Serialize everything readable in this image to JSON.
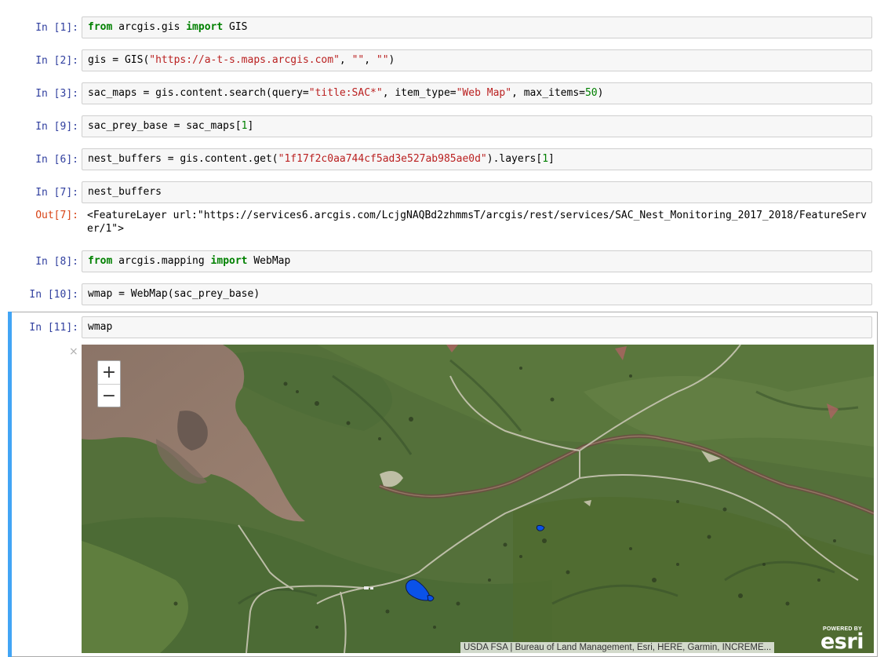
{
  "cells": [
    {
      "id": "c1",
      "prompt": "In [1]:",
      "tokens": [
        [
          "kw",
          "from"
        ],
        [
          "",
          " arcgis.gis "
        ],
        [
          "kw",
          "import"
        ],
        [
          "",
          " GIS"
        ]
      ]
    },
    {
      "id": "c2",
      "prompt": "In [2]:",
      "tokens": [
        [
          "",
          "gis = GIS("
        ],
        [
          "str",
          "\"https://a-t-s.maps.arcgis.com\""
        ],
        [
          "",
          ", "
        ],
        [
          "str",
          "\"\""
        ],
        [
          "",
          ", "
        ],
        [
          "str",
          "\"\""
        ],
        [
          "",
          ")"
        ]
      ]
    },
    {
      "id": "c3",
      "prompt": "In [3]:",
      "tokens": [
        [
          "",
          "sac_maps = gis.content.search(query="
        ],
        [
          "str",
          "\"title:SAC*\""
        ],
        [
          "",
          ", item_type="
        ],
        [
          "str",
          "\"Web Map\""
        ],
        [
          "",
          ", max_items="
        ],
        [
          "num",
          "50"
        ],
        [
          "",
          ")"
        ]
      ]
    },
    {
      "id": "c4",
      "prompt": "In [9]:",
      "tokens": [
        [
          "",
          "sac_prey_base = sac_maps["
        ],
        [
          "num",
          "1"
        ],
        [
          "",
          "]"
        ]
      ]
    },
    {
      "id": "c5",
      "prompt": "In [6]:",
      "tokens": [
        [
          "",
          "nest_buffers = gis.content.get("
        ],
        [
          "str",
          "\"1f17f2c0aa744cf5ad3e527ab985ae0d\""
        ],
        [
          "",
          ").layers["
        ],
        [
          "num",
          "1"
        ],
        [
          "",
          "]"
        ]
      ]
    },
    {
      "id": "c6",
      "prompt": "In [7]:",
      "tokens": [
        [
          "",
          "nest_buffers"
        ]
      ]
    },
    {
      "id": "c7",
      "prompt": "In [8]:",
      "tokens": [
        [
          "kw",
          "from"
        ],
        [
          "",
          " arcgis.mapping "
        ],
        [
          "kw",
          "import"
        ],
        [
          "",
          " WebMap"
        ]
      ]
    },
    {
      "id": "c8",
      "prompt": "In [10]:",
      "tokens": [
        [
          "",
          "wmap = WebMap(sac_prey_base)"
        ]
      ]
    },
    {
      "id": "c9",
      "prompt": "In [11]:",
      "tokens": [
        [
          "",
          "wmap"
        ]
      ]
    }
  ],
  "output7": {
    "prompt": "Out[7]:",
    "text": "<FeatureLayer url:\"https://services6.arcgis.com/LcjgNAQBd2zhmmsT/arcgis/rest/services/SAC_Nest_Monitoring_2017_2018/FeatureServer/1\">"
  },
  "widget": {
    "close_symbol": "×",
    "zoom_in": "+",
    "zoom_out": "−",
    "attribution": "USDA FSA | Bureau of Land Management, Esri, HERE, Garmin, INCREME...",
    "powered_by": "POWERED BY",
    "logo_text": "esri"
  },
  "colors": {
    "prompt_in": "#303f9f",
    "prompt_out": "#d84315",
    "keyword": "#008000",
    "string": "#ba2121",
    "number": "#008000",
    "selected_bar": "#42a5f5",
    "feature_fill": "#0a52e8"
  }
}
